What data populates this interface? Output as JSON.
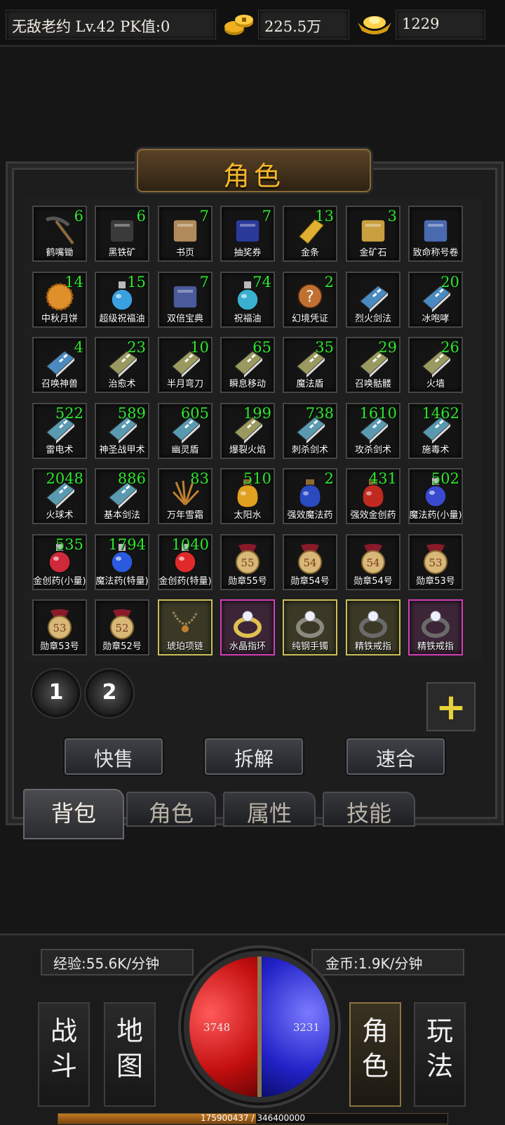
{
  "topbar": {
    "player": "无敌老约  Lv.42 PK值:0",
    "gold": "225.5万",
    "ingot": "1229"
  },
  "panel_title": "角色",
  "items": [
    {
      "name": "鹤嘴锄",
      "count": "6",
      "icon": "pickaxe-icon",
      "color": "#8a6a40",
      "frame": "normal"
    },
    {
      "name": "黑铁矿",
      "count": "6",
      "icon": "black-iron-ore-icon",
      "color": "#3a3a3a",
      "frame": "normal"
    },
    {
      "name": "书页",
      "count": "7",
      "icon": "book-page-icon",
      "color": "#b08a5a",
      "frame": "normal"
    },
    {
      "name": "抽奖券",
      "count": "7",
      "icon": "lottery-ticket-icon",
      "color": "#2a3a9a",
      "frame": "normal"
    },
    {
      "name": "金条",
      "count": "13",
      "icon": "gold-bar-icon",
      "color": "#e0b030",
      "frame": "normal"
    },
    {
      "name": "金矿石",
      "count": "3",
      "icon": "gold-ore-icon",
      "color": "#c8a040",
      "frame": "normal"
    },
    {
      "name": "致命称号卷",
      "count": "",
      "icon": "title-scroll-icon",
      "color": "#4a6ab0",
      "frame": "normal"
    },
    {
      "name": "中秋月饼",
      "count": "14",
      "icon": "mooncake-icon",
      "color": "#e0902a",
      "frame": "normal"
    },
    {
      "name": "超级祝福油",
      "count": "15",
      "icon": "potion-bottle-icon",
      "color": "#3aa0e0",
      "frame": "normal"
    },
    {
      "name": "双倍宝典",
      "count": "7",
      "icon": "double-book-icon",
      "color": "#4a5a9a",
      "frame": "normal"
    },
    {
      "name": "祝福油",
      "count": "74",
      "icon": "potion-bottle-icon",
      "color": "#3ab0d0",
      "frame": "normal"
    },
    {
      "name": "幻境凭证",
      "count": "2",
      "icon": "question-icon",
      "color": "#c07030",
      "frame": "normal"
    },
    {
      "name": "烈火剑法",
      "count": "",
      "icon": "skill-book-icon",
      "color": "#4a8ac0",
      "frame": "normal"
    },
    {
      "name": "冰咆哮",
      "count": "20",
      "icon": "skill-book-icon",
      "color": "#4a8ac0",
      "frame": "normal"
    },
    {
      "name": "召唤神兽",
      "count": "4",
      "icon": "skill-book-icon",
      "color": "#4a8ac0",
      "frame": "normal"
    },
    {
      "name": "治愈术",
      "count": "23",
      "icon": "skill-book-icon",
      "color": "#9a9a60",
      "frame": "normal"
    },
    {
      "name": "半月弯刀",
      "count": "10",
      "icon": "skill-book-icon",
      "color": "#9a9a60",
      "frame": "normal"
    },
    {
      "name": "瞬息移动",
      "count": "65",
      "icon": "skill-book-icon",
      "color": "#9a9a60",
      "frame": "normal"
    },
    {
      "name": "魔法盾",
      "count": "35",
      "icon": "skill-book-icon",
      "color": "#9a9a60",
      "frame": "normal"
    },
    {
      "name": "召唤骷髅",
      "count": "29",
      "icon": "skill-book-icon",
      "color": "#9a9a60",
      "frame": "normal"
    },
    {
      "name": "火墙",
      "count": "26",
      "icon": "skill-book-icon",
      "color": "#9a9a60",
      "frame": "normal"
    },
    {
      "name": "雷电术",
      "count": "522",
      "icon": "skill-book-icon",
      "color": "#5a9ab0",
      "frame": "normal"
    },
    {
      "name": "神圣战甲术",
      "count": "589",
      "icon": "skill-book-icon",
      "color": "#5a9ab0",
      "frame": "normal"
    },
    {
      "name": "幽灵盾",
      "count": "605",
      "icon": "skill-book-icon",
      "color": "#5a9ab0",
      "frame": "normal"
    },
    {
      "name": "爆裂火焰",
      "count": "199",
      "icon": "skill-book-icon",
      "color": "#9a9a60",
      "frame": "normal"
    },
    {
      "name": "刺杀剑术",
      "count": "738",
      "icon": "skill-book-icon",
      "color": "#5a9ab0",
      "frame": "normal"
    },
    {
      "name": "攻杀剑术",
      "count": "1610",
      "icon": "skill-book-icon",
      "color": "#5a9ab0",
      "frame": "normal"
    },
    {
      "name": "施毒术",
      "count": "1462",
      "icon": "skill-book-icon",
      "color": "#5a9ab0",
      "frame": "normal"
    },
    {
      "name": "火球术",
      "count": "2048",
      "icon": "skill-book-icon",
      "color": "#5a9ab0",
      "frame": "normal"
    },
    {
      "name": "基本剑法",
      "count": "886",
      "icon": "skill-book-icon",
      "color": "#5a9ab0",
      "frame": "normal"
    },
    {
      "name": "万年雪霜",
      "count": "83",
      "icon": "herb-root-icon",
      "color": "#c08030",
      "frame": "normal"
    },
    {
      "name": "太阳水",
      "count": "510",
      "icon": "sun-water-icon",
      "color": "#e0a020",
      "frame": "normal"
    },
    {
      "name": "强效魔法药",
      "count": "2",
      "icon": "mana-pouch-icon",
      "color": "#2a4ac0",
      "frame": "normal"
    },
    {
      "name": "强效金创药",
      "count": "431",
      "icon": "heal-pouch-icon",
      "color": "#c02a20",
      "frame": "normal"
    },
    {
      "name": "魔法药(小量)",
      "count": "502",
      "icon": "mana-flask-icon",
      "color": "#3a4ad0",
      "frame": "normal"
    },
    {
      "name": "金创药(小量)",
      "count": "535",
      "icon": "heal-flask-icon",
      "color": "#d02a3a",
      "frame": "normal"
    },
    {
      "name": "魔法药(特量)",
      "count": "1794",
      "icon": "mana-flask-icon",
      "color": "#2a5ae0",
      "frame": "normal"
    },
    {
      "name": "金创药(特量)",
      "count": "1040",
      "icon": "heal-flask-icon",
      "color": "#e02a2a",
      "frame": "normal"
    },
    {
      "name": "勋章55号",
      "count": "",
      "icon": "medal-icon",
      "color": "#d8b878",
      "frame": "normal",
      "badge": "55"
    },
    {
      "name": "勋章54号",
      "count": "",
      "icon": "medal-icon",
      "color": "#d8b878",
      "frame": "normal",
      "badge": "54"
    },
    {
      "name": "勋章54号",
      "count": "",
      "icon": "medal-icon",
      "color": "#d8b878",
      "frame": "normal",
      "badge": "54"
    },
    {
      "name": "勋章53号",
      "count": "",
      "icon": "medal-icon",
      "color": "#d8b878",
      "frame": "normal",
      "badge": "53"
    },
    {
      "name": "勋章53号",
      "count": "",
      "icon": "medal-icon",
      "color": "#d8b878",
      "frame": "normal",
      "badge": "53"
    },
    {
      "name": "勋章52号",
      "count": "",
      "icon": "medal-icon",
      "color": "#d8b878",
      "frame": "normal",
      "badge": "52"
    },
    {
      "name": "琥珀项链",
      "count": "",
      "icon": "necklace-icon",
      "color": "#a08a5a",
      "frame": "gold"
    },
    {
      "name": "水晶指环",
      "count": "",
      "icon": "crystal-ring-icon",
      "color": "#e0c050",
      "frame": "purple"
    },
    {
      "name": "纯钢手镯",
      "count": "",
      "icon": "bracelet-icon",
      "color": "#8a8a80",
      "frame": "gold"
    },
    {
      "name": "精铁戒指",
      "count": "",
      "icon": "iron-ring-icon",
      "color": "#6a6a6a",
      "frame": "gold"
    },
    {
      "name": "精铁戒指",
      "count": "",
      "icon": "iron-ring-icon",
      "color": "#6a6a6a",
      "frame": "purple"
    }
  ],
  "pages": [
    "1",
    "2"
  ],
  "add_label": "+",
  "actions": [
    "快售",
    "拆解",
    "速合"
  ],
  "tabs": [
    "背包",
    "角色",
    "属性",
    "技能"
  ],
  "active_tab": 0,
  "rates": {
    "exp": "经验:55.6K/分钟",
    "gold": "金币:1.9K/分钟"
  },
  "hp": "3748",
  "mp": "3231",
  "nav": {
    "left": [
      "战\n斗",
      "地\n图"
    ],
    "right": [
      "角\n色",
      "玩\n法"
    ],
    "selected": "角\n色"
  },
  "exp_text": "175900437 / 346400000",
  "exp_fraction": 0.508
}
